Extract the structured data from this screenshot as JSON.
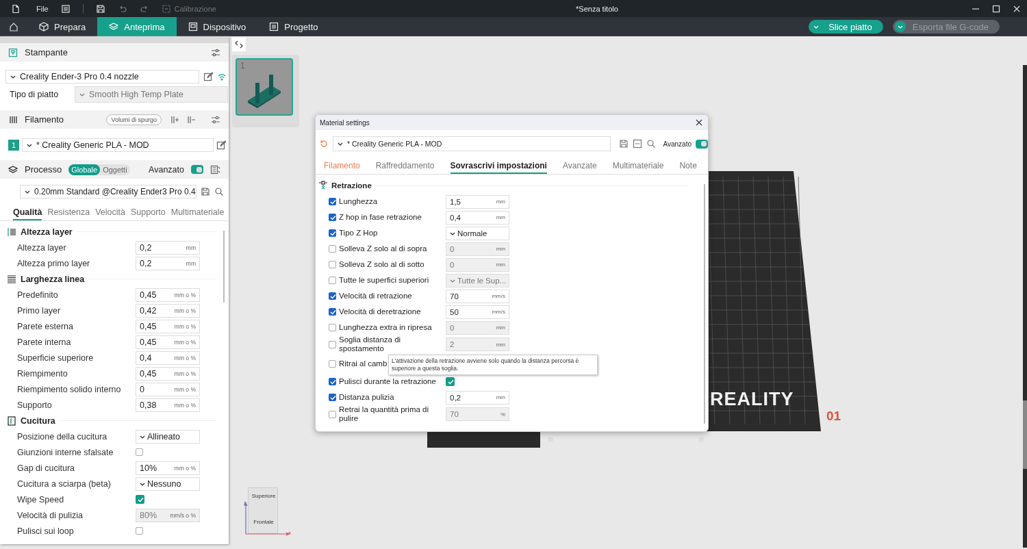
{
  "title_bar": {
    "menu": "File",
    "disabled_item": "Calibrazione",
    "title": "*Senza titolo"
  },
  "nav_tabs": [
    {
      "label": "Prepara",
      "selected": false
    },
    {
      "label": "Anteprima",
      "selected": true
    },
    {
      "label": "Dispositivo",
      "selected": false
    },
    {
      "label": "Progetto",
      "selected": false
    }
  ],
  "actions": [
    {
      "label": "Slice piatto",
      "disabled": false
    },
    {
      "label": "Esporta file G-code",
      "disabled": true
    }
  ],
  "sidebar": {
    "printer": {
      "title": "Stampante",
      "preset": "Creality Ender-3 Pro 0.4 nozzle",
      "plate_label": "Tipo di piatto",
      "plate": "Smooth High Temp Plate"
    },
    "filament": {
      "title": "Filamento",
      "purge_button": "Volumi di spurgo",
      "slots": [
        {
          "number": "1",
          "preset": "* Creality Generic PLA - MOD",
          "color": "#1f9e8a"
        }
      ]
    },
    "process": {
      "title": "Processo",
      "scopes": [
        {
          "label": "Globale",
          "selected": true
        },
        {
          "label": "Oggetti",
          "selected": false
        }
      ],
      "advanced_label": "Avanzato",
      "advanced": true,
      "preset": "0.20mm Standard @Creality Ender3 Pro 0.4"
    },
    "tabs": [
      {
        "label": "Qualità",
        "selected": true
      },
      {
        "label": "Resistenza",
        "selected": false
      },
      {
        "label": "Velocità",
        "selected": false
      },
      {
        "label": "Supporto",
        "selected": false
      },
      {
        "label": "Multimateriale",
        "selected": false
      }
    ],
    "sections": [
      {
        "title": "Altezza layer",
        "rows": [
          {
            "kind": "field",
            "label": "Altezza layer",
            "value": "0,2",
            "unit": "mm",
            "disabled": false
          },
          {
            "kind": "field",
            "label": "Altezza primo layer",
            "value": "0,2",
            "unit": "mm",
            "disabled": false
          }
        ]
      },
      {
        "title": "Larghezza linea",
        "rows": [
          {
            "kind": "field",
            "label": "Predefinito",
            "value": "0,45",
            "unit": "mm o %",
            "disabled": false
          },
          {
            "kind": "field",
            "label": "Primo layer",
            "value": "0,42",
            "unit": "mm o %",
            "disabled": false
          },
          {
            "kind": "field",
            "label": "Parete esterna",
            "value": "0,45",
            "unit": "mm o %",
            "disabled": false
          },
          {
            "kind": "field",
            "label": "Parete interna",
            "value": "0,45",
            "unit": "mm o %",
            "disabled": false
          },
          {
            "kind": "field",
            "label": "Superficie superiore",
            "value": "0,4",
            "unit": "mm o %",
            "disabled": false
          },
          {
            "kind": "field",
            "label": "Riempimento",
            "value": "0,45",
            "unit": "mm o %",
            "disabled": false
          },
          {
            "kind": "field",
            "label": "Riempimento solido interno",
            "value": "0",
            "unit": "mm o %",
            "disabled": false
          },
          {
            "kind": "field",
            "label": "Supporto",
            "value": "0,38",
            "unit": "mm o %",
            "disabled": false
          }
        ]
      },
      {
        "title": "Cucitura",
        "rows": [
          {
            "kind": "dropdown",
            "label": "Posizione della cucitura",
            "value": "Allineato"
          },
          {
            "kind": "checkbox",
            "label": "Giunzioni interne sfalsate",
            "checked": false
          },
          {
            "kind": "field",
            "label": "Gap di cucitura",
            "value": "10%",
            "unit": "mm o %",
            "disabled": false
          },
          {
            "kind": "dropdown",
            "label": "Cucitura a sciarpa (beta)",
            "value": "Nessuno"
          },
          {
            "kind": "checkbox",
            "label": "Wipe Speed",
            "checked": true
          },
          {
            "kind": "field",
            "label": "Velocità di pulizia",
            "value": "80%",
            "unit": "mm/s o %",
            "disabled": true
          },
          {
            "kind": "checkbox",
            "label": "Pulisci sui loop",
            "checked": false
          }
        ]
      }
    ]
  },
  "canvas": {
    "plates": [
      {
        "number": "1",
        "selected": true
      }
    ],
    "bed": {
      "logo": "REALITY",
      "model": "01"
    },
    "view_cube": {
      "top": "Superiore",
      "front": "Frontale",
      "z_axis": "z",
      "x_axis": "x"
    }
  },
  "dialog": {
    "title": "Material settings",
    "preset": "* Creality Generic PLA - MOD",
    "advanced_label": "Avanzato",
    "advanced": true,
    "tabs": [
      {
        "label": "Filamento",
        "selected": false,
        "modified": true
      },
      {
        "label": "Raffreddamento",
        "selected": false,
        "modified": false
      },
      {
        "label": "Sovrascrivi impostazioni",
        "selected": true,
        "modified": false
      },
      {
        "label": "Avanzate",
        "selected": false,
        "modified": false
      },
      {
        "label": "Multimateriale",
        "selected": false,
        "modified": false
      },
      {
        "label": "Note",
        "selected": false,
        "modified": false
      }
    ],
    "section": "Retrazione",
    "rows": [
      {
        "checked": true,
        "label": "Lunghezza",
        "kind": "field",
        "value": "1,5",
        "unit": "mm",
        "disabled": false
      },
      {
        "checked": true,
        "label": "Z hop in fase retrazione",
        "kind": "field",
        "value": "0,4",
        "unit": "mm",
        "disabled": false
      },
      {
        "checked": true,
        "label": "Tipo Z Hop",
        "kind": "dropdown",
        "value": "Normale",
        "disabled": false
      },
      {
        "checked": false,
        "label": "Solleva Z solo  al di sopra",
        "kind": "field",
        "value": "0",
        "unit": "mm",
        "disabled": true
      },
      {
        "checked": false,
        "label": "Solleva Z solo  al di sotto",
        "kind": "field",
        "value": "0",
        "unit": "mm",
        "disabled": true
      },
      {
        "checked": false,
        "label": "Tutte le superfici superiori",
        "kind": "dropdown",
        "value": "Tutte le Sup...",
        "disabled": true
      },
      {
        "checked": true,
        "label": "Velocità di retrazione",
        "kind": "field",
        "value": "70",
        "unit": "mm/s",
        "disabled": false
      },
      {
        "checked": true,
        "label": "Velocità di deretrazione",
        "kind": "field",
        "value": "50",
        "unit": "mm/s",
        "disabled": false
      },
      {
        "checked": false,
        "label": "Lunghezza extra in ripresa",
        "kind": "field",
        "value": "0",
        "unit": "mm",
        "disabled": true
      },
      {
        "checked": false,
        "label": "Soglia distanza di spostamento",
        "kind": "field",
        "value": "2",
        "unit": "mm",
        "disabled": true
      },
      {
        "checked": false,
        "label": "Ritrai al camb",
        "kind": "covered"
      },
      {
        "checked": true,
        "label": "Pulisci durante la retrazione",
        "kind": "checkbox",
        "on": true
      },
      {
        "checked": true,
        "label": "Distanza pulizia",
        "kind": "field",
        "value": "0,2",
        "unit": "mm",
        "disabled": false
      },
      {
        "checked": false,
        "label": "Retrai la quantità prima di pulire",
        "kind": "field",
        "value": "70",
        "unit": "%",
        "disabled": true
      }
    ],
    "tooltip": "L'attivazione della retrazione avviene solo quando la distanza percorsa è superiore a questa soglia."
  }
}
